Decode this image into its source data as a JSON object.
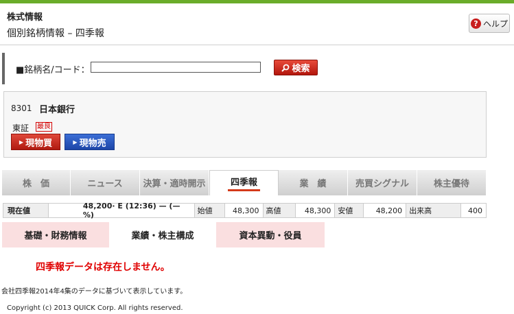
{
  "header": {
    "title": "株式情報",
    "subtitle": "個別銘柄情報 – 四季報",
    "help_label": "ヘルプ"
  },
  "search": {
    "label": "■銘柄名/コード：",
    "value": "",
    "button_label": "検索"
  },
  "stock": {
    "code": "8301",
    "name": "日本銀行",
    "market": "東証",
    "badge": "最良",
    "buy_label": "現物買",
    "sell_label": "現物売"
  },
  "tabs": [
    {
      "label": "株　価"
    },
    {
      "label": "ニュース"
    },
    {
      "label": "決算・適時開示"
    },
    {
      "label": "四季報"
    },
    {
      "label": "業　績"
    },
    {
      "label": "売買シグナル"
    },
    {
      "label": "株主優待"
    }
  ],
  "active_tab": "四季報",
  "quote": {
    "current_label": "現在値",
    "current_value": "48,200· E (12:36) — (— %)",
    "open_label": "始値",
    "open_value": "48,300",
    "high_label": "高値",
    "high_value": "48,300",
    "low_label": "安値",
    "low_value": "48,200",
    "volume_label": "出来高",
    "volume_value": "400"
  },
  "subtabs": [
    {
      "label": "基礎・財務情報"
    },
    {
      "label": "業績・株主構成"
    },
    {
      "label": "資本異動・役員"
    }
  ],
  "message": "四季報データは存在しません。",
  "note": "会社四季報2014年4集のデータに基づいて表示しています。",
  "copyright": "Copyright (c) 2013 QUICK Corp. All rights reserved.",
  "colors": {
    "accent_green": "#6aac2a",
    "buy_red": "#b01a10",
    "sell_blue": "#1d45a8",
    "message_red": "#e00000",
    "subtab_pink": "#fadfe0"
  }
}
